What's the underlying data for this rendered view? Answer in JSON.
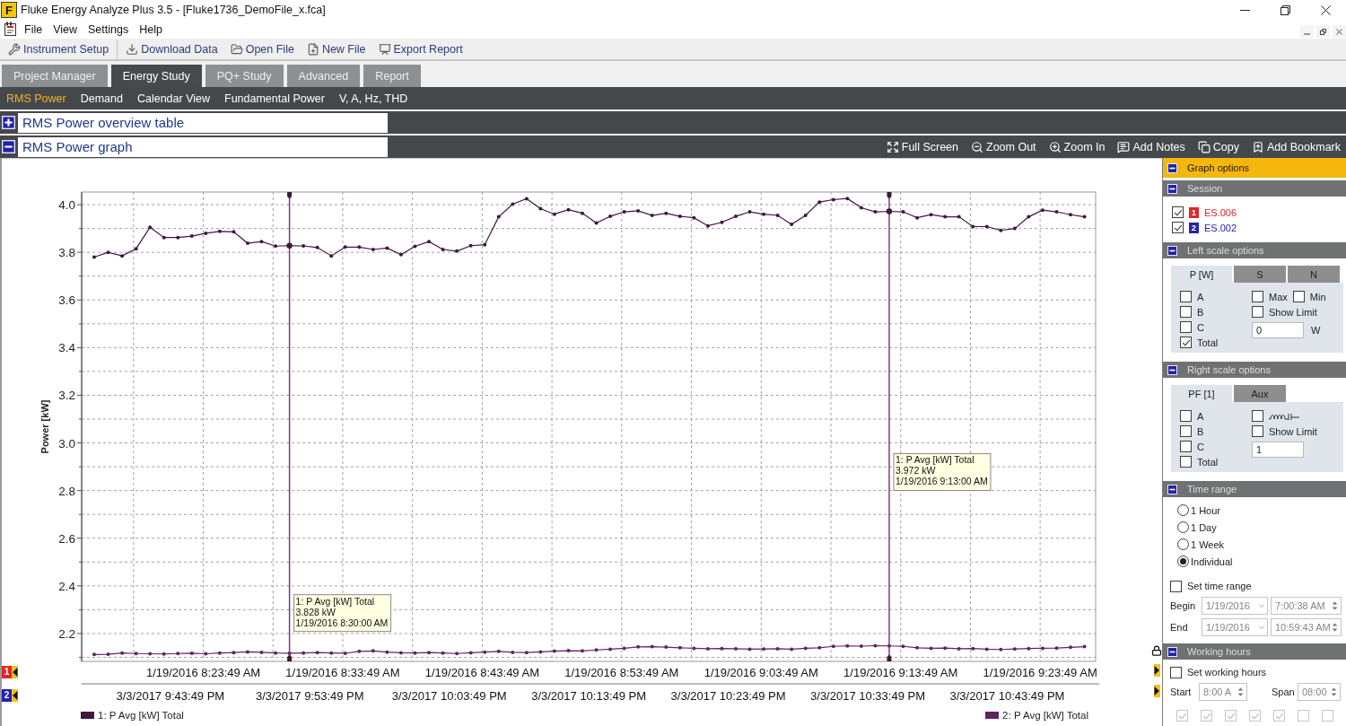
{
  "window": {
    "logo": "F",
    "title": "Fluke Energy Analyze Plus 3.5 - [Fluke1736_DemoFile_x.fca]"
  },
  "menu": [
    "File",
    "View",
    "Settings",
    "Help"
  ],
  "toolbar": [
    {
      "label": "Instrument Setup",
      "kind": "setup"
    },
    {
      "label": "Download Data",
      "kind": "download"
    },
    {
      "label": "Open File",
      "kind": "open"
    },
    {
      "label": "New File",
      "kind": "new"
    },
    {
      "label": "Export Report",
      "kind": "export"
    }
  ],
  "tabs": [
    {
      "label": "Project Manager",
      "selected": false
    },
    {
      "label": "Energy Study",
      "selected": true
    },
    {
      "label": "PQ+ Study",
      "selected": false
    },
    {
      "label": "Advanced",
      "selected": false
    },
    {
      "label": "Report",
      "selected": false
    }
  ],
  "views": [
    {
      "label": "RMS Power",
      "selected": true
    },
    {
      "label": "Demand",
      "selected": false
    },
    {
      "label": "Calendar View",
      "selected": false
    },
    {
      "label": "Fundamental Power",
      "selected": false
    },
    {
      "label": "V, A, Hz, THD",
      "selected": false
    }
  ],
  "sections": [
    {
      "title": "RMS Power overview table",
      "expanded": false
    },
    {
      "title": "RMS Power graph",
      "expanded": true,
      "tools": [
        {
          "label": "Full Screen",
          "kind": "fullscreen"
        },
        {
          "label": "Zoom Out",
          "kind": "zoom_out"
        },
        {
          "label": "Zoom In",
          "kind": "zoom_in"
        },
        {
          "label": "Add Notes",
          "kind": "notes"
        },
        {
          "label": "Copy",
          "kind": "copy"
        },
        {
          "label": "Add Bookmark",
          "kind": "bookmark"
        }
      ]
    }
  ],
  "graph": {
    "chart_data": {
      "type": "line",
      "grid": true,
      "legend": "bottom",
      "ylabel": "Power [kW]",
      "categories": [
        null,
        null,
        null,
        null,
        null,
        null,
        null,
        null,
        "1/19/2016 8:23:49 AM",
        null,
        null,
        null,
        null,
        null,
        null,
        null,
        null,
        null,
        "1/19/2016 8:33:49 AM",
        null,
        null,
        null,
        null,
        null,
        null,
        null,
        null,
        null,
        "1/19/2016 8:43:49 AM",
        null,
        null,
        null,
        null,
        null,
        null,
        null,
        null,
        null,
        "1/19/2016 8:53:49 AM",
        null,
        null,
        null,
        null,
        null,
        null,
        null,
        null,
        null,
        "1/19/2016 9:03:49 AM",
        null,
        null,
        null,
        null,
        null,
        null,
        null,
        null,
        null,
        "1/19/2016 9:13:49 AM",
        null,
        null,
        null,
        null,
        null,
        null,
        null,
        null,
        null,
        "1/19/2016 9:23:49 AM",
        null,
        null,
        null
      ],
      "series": [
        {
          "name": "1: P Avg [kW] Total",
          "color": "#3e1840",
          "values": [
            3.78,
            3.8,
            3.785,
            3.815,
            3.905,
            3.862,
            3.862,
            3.868,
            3.88,
            3.888,
            3.886,
            3.838,
            3.845,
            3.826,
            3.828,
            3.827,
            3.82,
            3.785,
            3.822,
            3.822,
            3.812,
            3.818,
            3.79,
            3.825,
            3.845,
            3.812,
            3.805,
            3.828,
            3.832,
            3.949,
            4.002,
            4.025,
            3.983,
            3.96,
            3.979,
            3.964,
            3.923,
            3.951,
            3.97,
            3.974,
            3.955,
            3.964,
            3.951,
            3.945,
            3.911,
            3.926,
            3.951,
            3.97,
            3.96,
            3.955,
            3.917,
            3.955,
            4.011,
            4.021,
            4.026,
            3.987,
            3.97,
            3.972,
            3.97,
            3.945,
            3.958,
            3.949,
            3.949,
            3.908,
            3.908,
            3.892,
            3.9,
            3.949,
            3.977,
            3.97,
            3.958,
            3.949
          ]
        },
        {
          "name": "2: P Avg [kW] Total",
          "color": "#5e2462",
          "values": [
            2.112,
            2.113,
            2.118,
            2.116,
            2.115,
            2.114,
            2.116,
            2.117,
            2.115,
            2.118,
            2.12,
            2.123,
            2.121,
            2.118,
            2.117,
            2.118,
            2.12,
            2.118,
            2.117,
            2.125,
            2.127,
            2.122,
            2.119,
            2.118,
            2.12,
            2.118,
            2.116,
            2.119,
            2.122,
            2.125,
            2.121,
            2.12,
            2.123,
            2.126,
            2.128,
            2.127,
            2.131,
            2.134,
            2.138,
            2.144,
            2.145,
            2.143,
            2.14,
            2.138,
            2.136,
            2.137,
            2.136,
            2.134,
            2.135,
            2.136,
            2.134,
            2.138,
            2.14,
            2.146,
            2.148,
            2.147,
            2.149,
            2.148,
            2.146,
            2.14,
            2.138,
            2.139,
            2.136,
            2.137,
            2.134,
            2.133,
            2.135,
            2.137,
            2.138,
            2.139,
            2.142,
            2.145
          ]
        }
      ],
      "ylim": [
        2.083,
        4.053
      ],
      "yticks": [
        2.2,
        2.4,
        2.6,
        2.8,
        {
          "value": 3,
          "label": "3.0"
        },
        3.2,
        3.4,
        3.6,
        3.8,
        {
          "value": 4,
          "label": "4.0"
        }
      ],
      "annotations": [
        "1: P Avg [kW] Total\n3.828 kW\n1/19/2016 8:30:00 AM",
        "1: P Avg [kW] Total\n3.972 kW\n1/19/2016 9:13:00 AM"
      ]
    },
    "second_axis_labels": [
      "3/3/2017 9:43:49 PM",
      "3/3/2017 9:53:49 PM",
      "3/3/2017 10:03:49 PM",
      "3/3/2017 10:13:49 PM",
      "3/3/2017 10:23:49 PM",
      "3/3/2017 10:33:49 PM",
      "3/3/2017 10:43:49 PM"
    ],
    "axis_markers": [
      {
        "label": "1",
        "color": "#e0262a"
      },
      {
        "label": "2",
        "color": "#2222b4"
      }
    ]
  },
  "graph_options": {
    "title": "Graph options",
    "expanded": true,
    "session": {
      "title": "Session",
      "expanded": true,
      "items": [
        {
          "marker": "1",
          "name": "ES.006",
          "color": "#d8282c",
          "checked": true
        },
        {
          "marker": "2",
          "name": "ES.002",
          "color": "#2424a8",
          "checked": true
        }
      ]
    },
    "left_scale": {
      "title": "Left scale options",
      "expanded": true,
      "tabs": [
        {
          "label": "P [W]",
          "selected": true
        },
        {
          "label": "S",
          "selected": false
        },
        {
          "label": "N",
          "selected": false
        }
      ],
      "phases": [
        {
          "label": "A",
          "checked": false
        },
        {
          "label": "B",
          "checked": false
        },
        {
          "label": "C",
          "checked": false
        },
        {
          "label": "Total",
          "checked": true
        }
      ],
      "extra_rows": [
        {
          "items": [
            {
              "kind": "text",
              "label": "Max",
              "checked": false
            },
            {
              "kind": "text",
              "label": "Min",
              "checked": false
            }
          ]
        },
        {
          "items": [
            {
              "kind": "text",
              "label": "Show Limit",
              "checked": false
            }
          ]
        }
      ],
      "limit": {
        "value": "0",
        "unit": "W"
      }
    },
    "right_scale": {
      "title": "Right scale options",
      "expanded": true,
      "tabs": [
        {
          "label": "PF [1]",
          "selected": true
        },
        {
          "label": "Aux",
          "selected": false
        }
      ],
      "phases": [
        {
          "label": "A",
          "checked": false
        },
        {
          "label": "B",
          "checked": false
        },
        {
          "label": "C",
          "checked": false
        },
        {
          "label": "Total",
          "checked": false
        }
      ],
      "extra_rows": [
        {
          "items": [
            {
              "kind": "symbol",
              "checked": false
            }
          ]
        },
        {
          "items": [
            {
              "kind": "text",
              "label": "Show Limit",
              "checked": false
            }
          ]
        }
      ],
      "limit": {
        "value": "1"
      }
    },
    "time_range": {
      "title": "Time range",
      "expanded": true,
      "options": [
        {
          "label": "1 Hour",
          "selected": false
        },
        {
          "label": "1 Day",
          "selected": false
        },
        {
          "label": "1 Week",
          "selected": false
        },
        {
          "label": "Individual",
          "selected": true
        }
      ],
      "set_time_range": {
        "label": "Set time range",
        "checked": false
      },
      "begin": {
        "label": "Begin",
        "date": "1/19/2016",
        "time": "7:00:38 AM"
      },
      "end": {
        "label": "End",
        "date": "1/19/2016",
        "time": "10:59:43 AM"
      }
    },
    "working_hours": {
      "title": "Working hours",
      "expanded": true,
      "set_working_hours": {
        "label": "Set working hours",
        "checked": false
      },
      "start": {
        "label": "Start",
        "value": "8:00 A"
      },
      "span": {
        "label": "Span",
        "value": "08:00"
      },
      "days": [
        {
          "checked": true
        },
        {
          "checked": true
        },
        {
          "checked": true
        },
        {
          "checked": true
        },
        {
          "checked": true
        },
        {
          "checked": false
        },
        {
          "checked": false
        }
      ]
    }
  }
}
